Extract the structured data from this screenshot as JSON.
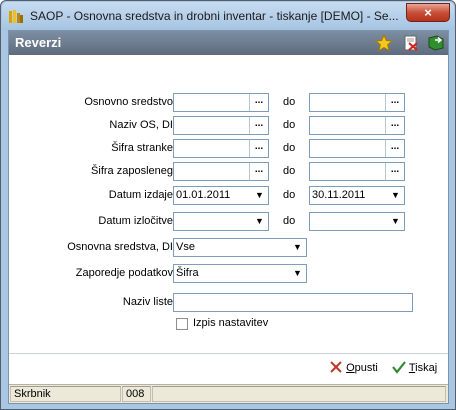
{
  "window": {
    "title": "SAOP -  Osnovna sredstva in drobni inventar - tiskanje [DEMO] - Se...",
    "close_label": "×"
  },
  "header": {
    "title": "Reverzi",
    "icons": [
      "star-icon",
      "delete-document-icon",
      "exit-book-icon"
    ]
  },
  "form": {
    "do_label": "do",
    "rows": [
      {
        "label": "Osnovno sredstvo",
        "from": "",
        "to": "",
        "button": "..."
      },
      {
        "label": "Naziv OS, DI",
        "from": "",
        "to": "",
        "button": "..."
      },
      {
        "label": "Šifra stranke",
        "from": "",
        "to": "",
        "button": "..."
      },
      {
        "label": "Šifra zaposleneg",
        "from": "",
        "to": "",
        "button": "..."
      },
      {
        "label": "Datum izdaje",
        "from": "01.01.2011",
        "to": "30.11.2011"
      },
      {
        "label": "Datum izločitve",
        "from": "",
        "to": ""
      }
    ],
    "osnovna_sredstva_di": {
      "label": "Osnovna sredstva, DI",
      "value": "Vse"
    },
    "zaporedje_podatkov": {
      "label": "Zaporedje podatkov",
      "value": "Šifra"
    },
    "naziv_liste": {
      "label": "Naziv liste",
      "value": ""
    },
    "izpis_nastavitev": {
      "label": "Izpis nastavitev",
      "checked": false
    }
  },
  "buttons": {
    "opusti": {
      "underlined": "O",
      "rest": "pusti"
    },
    "tiskaj": {
      "underlined": "T",
      "rest": "iskaj"
    }
  },
  "status": {
    "user": "Skrbnik",
    "code": "008",
    "extra": ""
  },
  "colors": {
    "header_bar": "#5d6b7d",
    "cancel_x": "#c0392b",
    "ok_check": "#2e8b2e"
  }
}
